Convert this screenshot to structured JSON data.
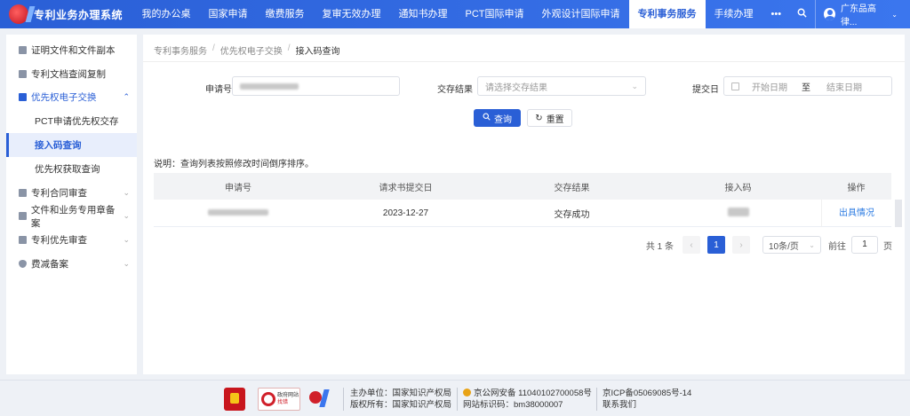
{
  "header": {
    "title": "专利业务办理系统",
    "nav": [
      "我的办公桌",
      "国家申请",
      "缴费服务",
      "复审无效办理",
      "通知书办理",
      "PCT国际申请",
      "外观设计国际申请",
      "专利事务服务",
      "手续办理",
      "•••"
    ],
    "active_nav": "专利事务服务",
    "user": "广东品高律...",
    "colors": {
      "primary": "#2a5fd6"
    }
  },
  "sidebar": {
    "items": [
      {
        "label": "证明文件和文件副本",
        "icon": "document-icon"
      },
      {
        "label": "专利文档查阅复制",
        "icon": "archive-icon"
      },
      {
        "label": "优先权电子交换",
        "icon": "exchange-icon",
        "chev": "⌃"
      },
      {
        "label": "PCT申请优先权交存"
      },
      {
        "label": "接入码查询"
      },
      {
        "label": "优先权获取查询"
      },
      {
        "label": "专利合同审查",
        "icon": "contract-icon",
        "chev": "⌄"
      },
      {
        "label": "文件和业务专用章备案",
        "icon": "seal-icon",
        "chev": "⌄"
      },
      {
        "label": "专利优先审查",
        "icon": "priority-icon",
        "chev": "⌄"
      },
      {
        "label": "费减备案",
        "icon": "shield-icon",
        "chev": "⌄"
      }
    ]
  },
  "breadcrumb": [
    "专利事务服务",
    "优先权电子交换",
    "接入码查询"
  ],
  "form": {
    "app_no_label": "申请号",
    "result_label": "交存结果",
    "result_placeholder": "请选择交存结果",
    "date_label": "提交日",
    "date_start_placeholder": "开始日期",
    "date_to": "至",
    "date_end_placeholder": "结束日期",
    "search_label": "查询",
    "reset_label": "重置"
  },
  "note": "说明：查询列表按照修改时间倒序排序。",
  "table": {
    "headers": [
      "申请号",
      "请求书提交日",
      "交存结果",
      "接入码",
      "操作"
    ],
    "rows": [
      {
        "app_no": "",
        "submit_date": "2023-12-27",
        "result": "交存成功",
        "access_code": "",
        "action": "出具情况"
      }
    ]
  },
  "pager": {
    "total": "共 1 条",
    "prev": "‹",
    "page": "1",
    "next": "›",
    "size": "10条/页",
    "goto": "前往",
    "goto_value": "1",
    "page_unit": "页"
  },
  "footer": {
    "gov_line1": "政府网站",
    "gov_line2": "找错",
    "sponsor": "主办单位：国家知识产权局",
    "copyright": "版权所有：国家知识产权局",
    "police": "京公网安备 11040102700058号",
    "site_id": "网站标识码：bm38000007",
    "icp": "京ICP备05069085号-14",
    "contact": "联系我们"
  }
}
